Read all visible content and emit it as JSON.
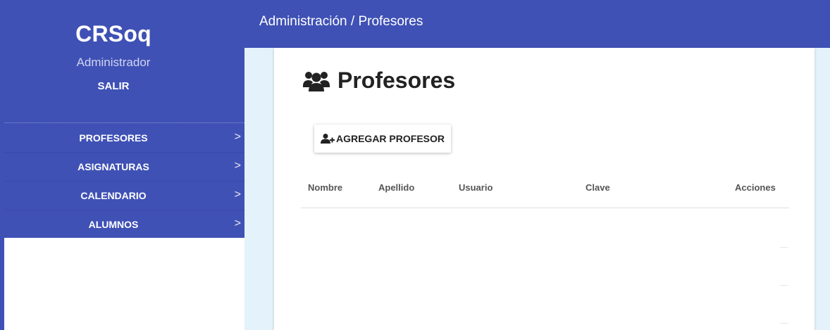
{
  "sidebar": {
    "brand": "CRSoq",
    "role": "Administrador",
    "logout_label": "SALIR",
    "items": [
      {
        "label": "PROFESORES"
      },
      {
        "label": "ASIGNATURAS"
      },
      {
        "label": "CALENDARIO"
      },
      {
        "label": "ALUMNOS"
      }
    ],
    "chevron": ">"
  },
  "header": {
    "breadcrumb": "Administración / Profesores"
  },
  "main": {
    "title": "Profesores",
    "title_icon": "users-icon",
    "add_button_label": "AGREGAR PROFESOR",
    "add_button_icon": "user-plus-icon",
    "table": {
      "columns": [
        "Nombre",
        "Apellido",
        "Usuario",
        "Clave",
        "Acciones"
      ],
      "rows": []
    }
  },
  "colors": {
    "primary": "#3f51b5",
    "content_bg": "#e3f2fb",
    "card_bg": "#ffffff"
  }
}
